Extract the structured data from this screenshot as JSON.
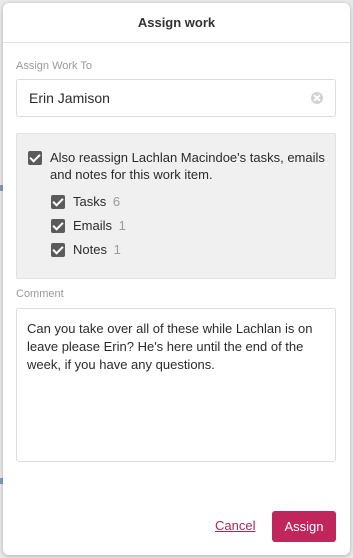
{
  "modal": {
    "title": "Assign work"
  },
  "assign_to": {
    "label": "Assign Work To",
    "value": "Erin Jamison"
  },
  "reassign": {
    "checked": true,
    "text": "Also reassign Lachlan Macindoe's tasks, emails and notes for this work item.",
    "items": [
      {
        "label": "Tasks",
        "count": "6",
        "checked": true
      },
      {
        "label": "Emails",
        "count": "1",
        "checked": true
      },
      {
        "label": "Notes",
        "count": "1",
        "checked": true
      }
    ]
  },
  "comment": {
    "label": "Comment",
    "value": "Can you take over all of these while Lachlan is on leave please Erin? He's here until the end of the week, if you have any questions."
  },
  "actions": {
    "cancel_label": "Cancel",
    "assign_label": "Assign"
  },
  "colors": {
    "accent": "#c0265c",
    "checkbox": "#5b5b5b",
    "panel_bg": "#f0f0f0"
  },
  "icons": {
    "clear": "clear-icon",
    "check": "checkmark"
  }
}
